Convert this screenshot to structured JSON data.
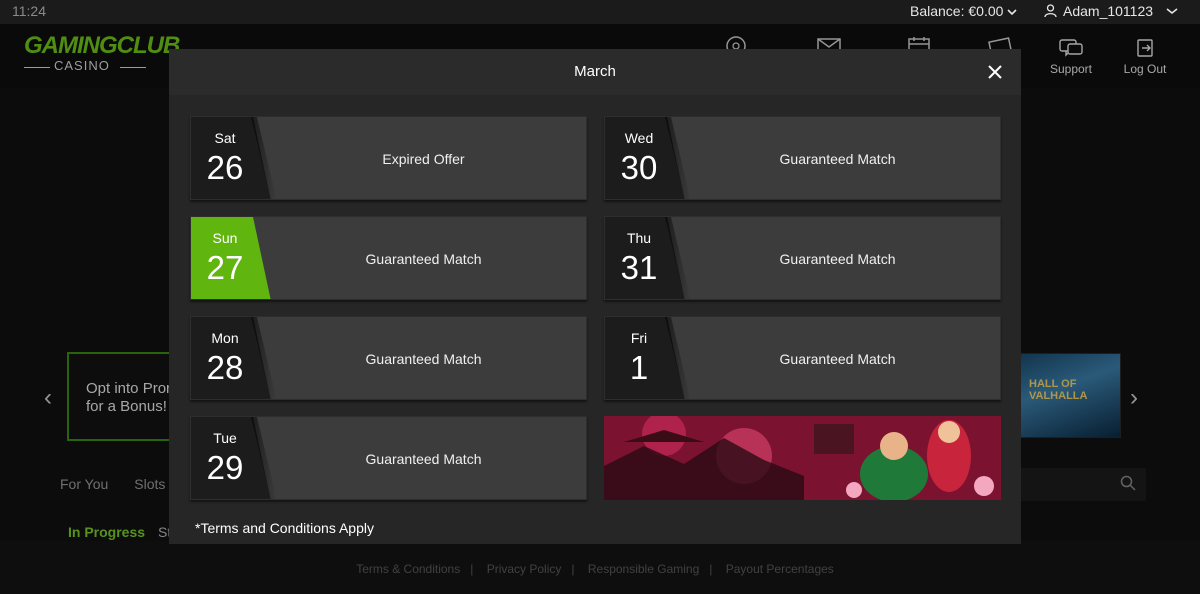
{
  "status_bar": {
    "time": "11:24",
    "balance": "Balance: €0.00",
    "username": "Adam_101123"
  },
  "header": {
    "logo_main": "GAMINGCLUB",
    "logo_sub": "CASINO",
    "nav": [
      {
        "label": "Support",
        "icon": "support-chat-icon"
      },
      {
        "label": "Log Out",
        "icon": "logout-icon"
      }
    ],
    "icons": [
      "roulette-icon",
      "mail-icon",
      "calendar-icon",
      "cards-icon"
    ]
  },
  "background_page": {
    "promo_text_line1": "Opt into Pron",
    "promo_text_line2": "for a Bonus!",
    "tabs": [
      "For You",
      "Slots"
    ],
    "section_active": "In Progress",
    "section_other": "St",
    "game_title": "HALL OF VALHALLA"
  },
  "footer": {
    "links": [
      "Terms & Conditions",
      "Privacy Policy",
      "Responsible Gaming",
      "Payout Percentages"
    ]
  },
  "modal": {
    "title": "March",
    "days": [
      {
        "dow": "Sat",
        "date": "26",
        "offer": "Expired Offer",
        "active": false
      },
      {
        "dow": "Sun",
        "date": "27",
        "offer": "Guaranteed Match",
        "active": true
      },
      {
        "dow": "Mon",
        "date": "28",
        "offer": "Guaranteed Match",
        "active": false
      },
      {
        "dow": "Tue",
        "date": "29",
        "offer": "Guaranteed Match",
        "active": false
      },
      {
        "dow": "Wed",
        "date": "30",
        "offer": "Guaranteed Match",
        "active": false
      },
      {
        "dow": "Thu",
        "date": "31",
        "offer": "Guaranteed Match",
        "active": false
      },
      {
        "dow": "Fri",
        "date": "1",
        "offer": "Guaranteed Match",
        "active": false
      }
    ],
    "terms": "*Terms and Conditions Apply"
  },
  "colors": {
    "accent_green": "#61b50f",
    "modal_bg": "#262626",
    "tile_bg": "#3c3c3c"
  }
}
